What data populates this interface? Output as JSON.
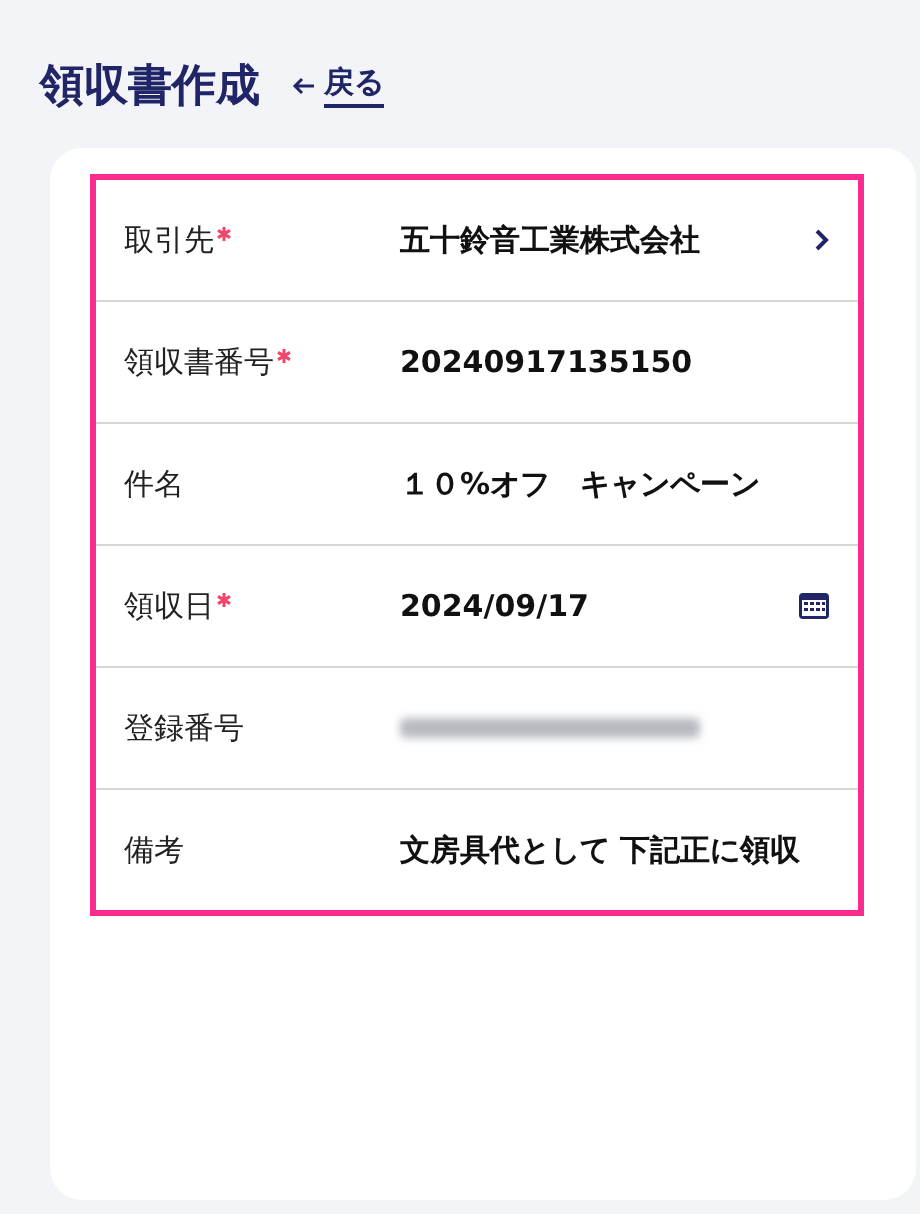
{
  "header": {
    "title": "領収書作成",
    "back_link": "戻る"
  },
  "form": {
    "highlighted": true,
    "rows": [
      {
        "label": "取引先",
        "required": true,
        "kind": "link",
        "value": "五十鈴音工業株式会社"
      },
      {
        "label": "領収書番号",
        "required": true,
        "kind": "text",
        "value": "20240917135150"
      },
      {
        "label": "件名",
        "required": false,
        "kind": "text",
        "value": "１０%オフ　キャンペーン"
      },
      {
        "label": "領収日",
        "required": true,
        "kind": "date",
        "value": "2024/09/17"
      },
      {
        "label": "登録番号",
        "required": false,
        "kind": "redacted"
      },
      {
        "label": "備考",
        "required": false,
        "kind": "text",
        "value": "文房具代として 下記正に領収"
      }
    ]
  }
}
